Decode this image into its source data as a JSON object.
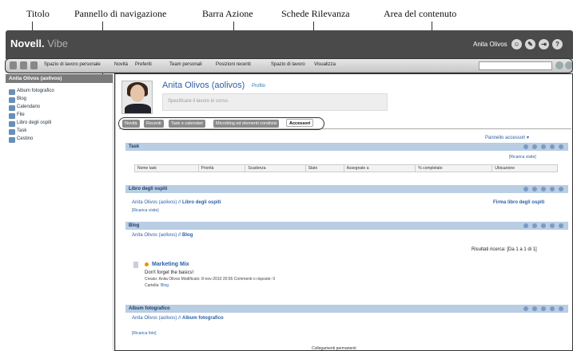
{
  "annotations": {
    "title": "Titolo",
    "nav": "Pannello di navigazione",
    "action": "Barra Azione",
    "tabs": "Schede Rilevanza",
    "content": "Area del contenuto"
  },
  "header": {
    "brand": "Novell.",
    "product": "Vibe",
    "user": "Anita Olivos"
  },
  "actionbar": {
    "items": [
      "Spazio di lavoro personale",
      "Novità",
      "Preferiti",
      "Team personali",
      "Posizioni recenti",
      "Spazio di lavoro",
      "Visualizza"
    ]
  },
  "sidebar": {
    "header": "Anita Olivos (aolivos)",
    "items": [
      "Album fotografico",
      "Blog",
      "Calendario",
      "File",
      "Libro degli ospiti",
      "Task",
      "Cestino"
    ]
  },
  "profile": {
    "name": "Anita Olivos (aolivos)",
    "profile_link": "Profilo",
    "status_placeholder": "Specificare il lavoro in corso."
  },
  "tabs": [
    "Novità",
    "Recenti",
    "Task e calendari",
    "Microblog ed elementi condivisi",
    "Accessori"
  ],
  "accessory_panel": "Pannello accessori",
  "task": {
    "title": "Task",
    "reload": "[Ricarica visite]",
    "columns": [
      "Nome task",
      "Priorità",
      "Scadenza",
      "Stato",
      "Assegnato a",
      "% completato",
      "Ubicazione"
    ]
  },
  "guestbook": {
    "title": "Libro degli ospiti",
    "path_prefix": "Anita Olivos (aolivos) //",
    "path_name": "Libro degli ospiti",
    "sign": "Firma libro degli ospiti",
    "reload": "[Ricarica visite]"
  },
  "blog": {
    "title": "Blog",
    "path_prefix": "Anita Olivos (aolivos) //",
    "path_name": "Blog",
    "results": "Risultati ricerca: [Da 1 a 1 di 1]",
    "post_title": "Marketing Mix",
    "post_body": "Don't forget the basics!",
    "post_meta": "Creato:   Anita Olivos   Modificato: 8-nov-2010 20:55   Commenti o risposte: 0",
    "post_folder_label": "Cartella:",
    "post_folder": "Blog"
  },
  "album": {
    "title": "Album fotografico",
    "path_prefix": "Anita Olivos (aolivos) //",
    "path_name": "Album fotografico",
    "reload": "[Ricarica foto]"
  },
  "footer": "Collegamenti permanenti"
}
